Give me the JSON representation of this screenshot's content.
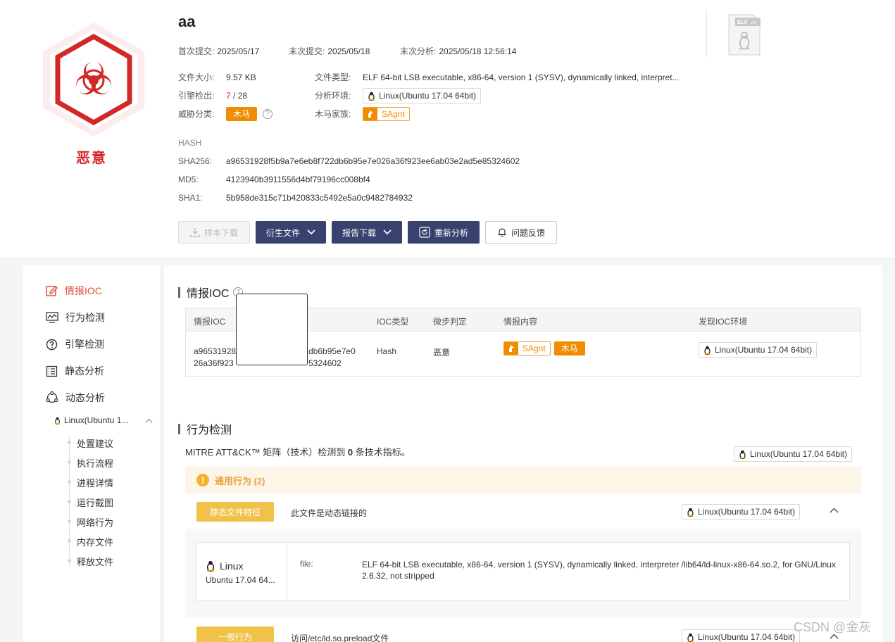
{
  "file": {
    "name": "aa",
    "verdict": "恶意",
    "first_submit_label": "首次提交:",
    "first_submit": "2025/05/17",
    "last_submit_label": "末次提交:",
    "last_submit": "2025/05/18",
    "last_analysis_label": "末次分析:",
    "last_analysis": "2025/05/18 12:56:14",
    "size_label": "文件大小:",
    "size": "9.57 KB",
    "type_label": "文件类型:",
    "type": "ELF 64-bit LSB executable, x86-64, version 1 (SYSV), dynamically linked, interpret...",
    "engine_label": "引擎检出:",
    "engine_detected": "7",
    "engine_total": "/ 28",
    "env_label": "分析环境:",
    "env": "Linux(Ubuntu 17.04 64bit)",
    "threat_label": "威胁分类:",
    "threat": "木马",
    "family_label": "木马家族:",
    "family": "SAgnt",
    "elf_badge": "ELF x64"
  },
  "hash": {
    "title": "HASH",
    "sha256_label": "SHA256:",
    "sha256": "a96531928f5b9a7e6eb8f722db6b95e7e026a36f923ee6ab03e2ad5e85324602",
    "md5_label": "MD5:",
    "md5": "4123940b3911556d4bf79196cc008bf4",
    "sha1_label": "SHA1:",
    "sha1": "5b958de315c71b420833c5492e5a0c9482784932"
  },
  "actions": {
    "sample_download": "样本下载",
    "derived_files": "衍生文件",
    "report_download": "报告下载",
    "reanalyze": "重新分析",
    "feedback": "问题反馈"
  },
  "sidebar": {
    "items": [
      {
        "label": "情报IOC",
        "icon": "edit-icon"
      },
      {
        "label": "行为检测",
        "icon": "chart-icon"
      },
      {
        "label": "引擎检测",
        "icon": "question-circle-icon"
      },
      {
        "label": "静态分析",
        "icon": "list-icon"
      },
      {
        "label": "动态分析",
        "icon": "cycle-icon"
      }
    ],
    "env": "Linux(Ubuntu 1...",
    "sub_items": [
      "处置建议",
      "执行流程",
      "进程详情",
      "运行截图",
      "网络行为",
      "内存文件",
      "释放文件"
    ]
  },
  "ioc": {
    "title": "情报IOC",
    "headers": [
      "情报IOC",
      "IOC类型",
      "微步判定",
      "情报内容",
      "发现IOC环境"
    ],
    "row": {
      "ioc_line1": "a96531928",
      "ioc_line1b": "db6b95e7e0",
      "ioc_line2": "26a36f923",
      "ioc_line2b": "5324602",
      "type": "Hash",
      "verdict": "恶意",
      "family": "SAgnt",
      "category": "木马",
      "env": "Linux(Ubuntu 17.04 64bit)"
    }
  },
  "behavior": {
    "title": "行为检测",
    "mitre_prefix": "MITRE ATT&CK™ 矩阵（技术）检测到",
    "mitre_count": "0",
    "mitre_suffix": "条技术指标。",
    "env": "Linux(Ubuntu 17.04 64bit)",
    "general_title": "通用行为 (2)",
    "rows": [
      {
        "tag": "静态文件特征",
        "desc": "此文件是动态链接的",
        "env": "Linux(Ubuntu 17.04 64bit)"
      },
      {
        "tag": "一般行为",
        "desc": "访问/etc/ld.so.preload文件",
        "env": "Linux(Ubuntu 17.04 64bit)"
      }
    ],
    "detail": {
      "os": "Linux",
      "os_version": "Ubuntu 17.04 64...",
      "key": "file:",
      "value": "ELF 64-bit LSB executable, x86-64, version 1 (SYSV), dynamically linked, interpreter /lib64/ld-linux-x86-64.so.2, for GNU/Linux 2.6.32, not stripped"
    }
  },
  "watermark": "CSDN @金灰",
  "colors": {
    "malicious": "#d42727",
    "accent_dark": "#39426f",
    "orange": "#f08c00",
    "active_nav": "#e24a3b"
  }
}
